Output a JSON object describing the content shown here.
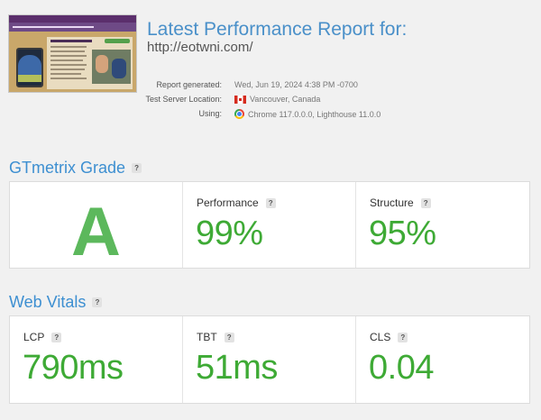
{
  "header": {
    "title": "Latest Performance Report for:",
    "url": "http://eotwni.com/"
  },
  "meta": [
    {
      "label": "Report generated:",
      "value": "Wed, Jun 19, 2024 4:38 PM -0700",
      "icon": ""
    },
    {
      "label": "Test Server Location:",
      "value": "Vancouver, Canada",
      "icon": "canada-flag-icon"
    },
    {
      "label": "Using:",
      "value": "Chrome 117.0.0.0, Lighthouse 11.0.0",
      "icon": "chrome-icon"
    }
  ],
  "grade_section": {
    "title": "GTmetrix Grade",
    "help": "?",
    "grade": "A",
    "performance": {
      "label": "Performance",
      "value": "99%"
    },
    "structure": {
      "label": "Structure",
      "value": "95%"
    }
  },
  "vitals_section": {
    "title": "Web Vitals",
    "help": "?",
    "lcp": {
      "label": "LCP",
      "value": "790ms"
    },
    "tbt": {
      "label": "TBT",
      "value": "51ms"
    },
    "cls": {
      "label": "CLS",
      "value": "0.04"
    }
  },
  "colors": {
    "title_blue": "#4a90c9",
    "section_blue": "#3d8fd1",
    "metric_green": "#3eaa35",
    "grade_green": "#5cb85c"
  }
}
